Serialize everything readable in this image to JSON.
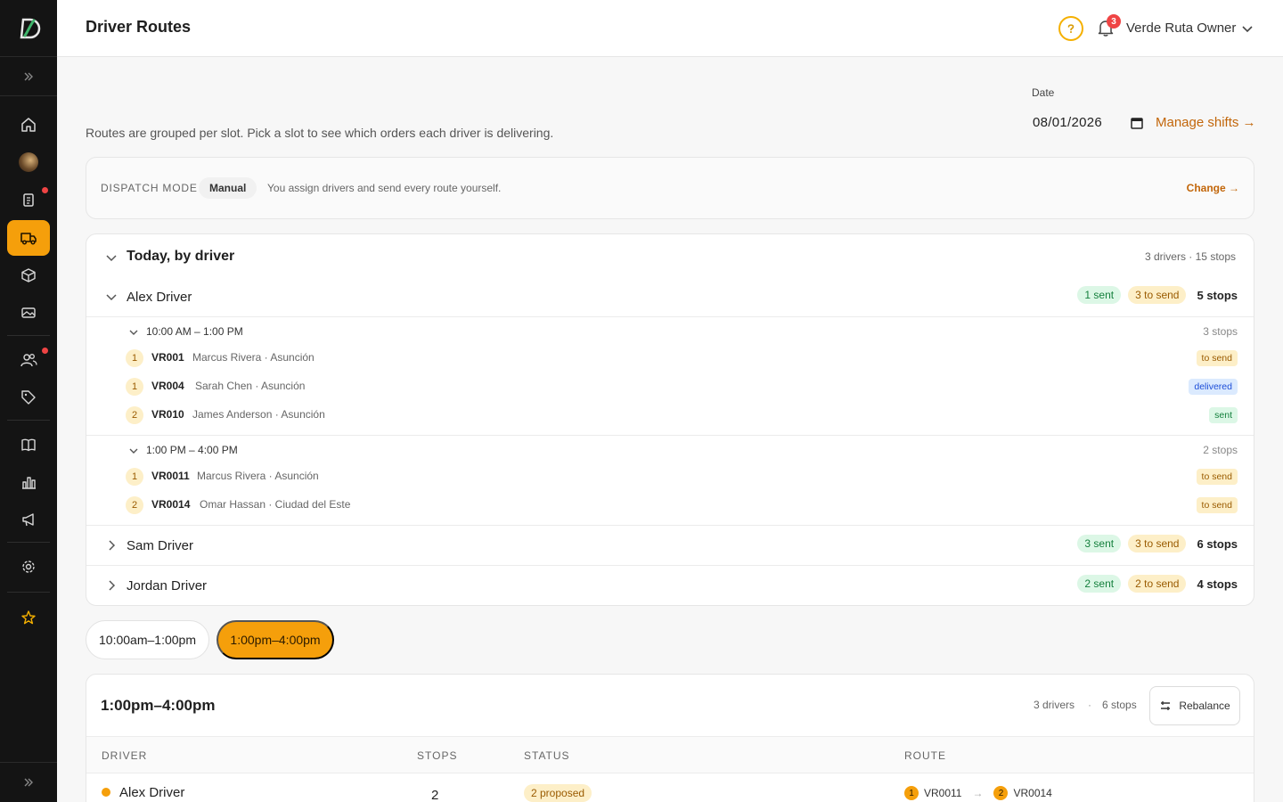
{
  "header": {
    "title": "Driver Routes",
    "notifications_count": "3",
    "user_name": "Verde Ruta Owner"
  },
  "intro": "Routes are grouped per slot. Pick a slot to see which orders each driver is delivering.",
  "date": {
    "label": "Date",
    "value": "08/01/2026",
    "manage_link": "Manage shifts →"
  },
  "dispatch": {
    "label": "DISPATCH MODE",
    "mode": "Manual",
    "description": "You assign drivers and send every route yourself.",
    "change": "Change →"
  },
  "today": {
    "title": "Today, by driver",
    "meta": "3 drivers · 15 stops",
    "drivers": [
      {
        "name": "Alex Driver",
        "sent": "1 sent",
        "to_send": "3 to send",
        "stops": "5 stops",
        "slots": [
          {
            "label": "10:00 AM – 1:00 PM",
            "stops": "3 stops",
            "orders": [
              {
                "seq": "1",
                "code": "VR001",
                "customer": "Marcus Rivera · Asunción",
                "status": "to send"
              },
              {
                "seq": "1",
                "code": "VR004",
                "customer": "Sarah Chen · Asunción",
                "status": "delivered"
              },
              {
                "seq": "2",
                "code": "VR010",
                "customer": "James Anderson · Asunción",
                "status": "sent"
              }
            ]
          },
          {
            "label": "1:00 PM – 4:00 PM",
            "stops": "2 stops",
            "orders": [
              {
                "seq": "1",
                "code": "VR0011",
                "customer": "Marcus Rivera · Asunción",
                "status": "to send"
              },
              {
                "seq": "2",
                "code": "VR0014",
                "customer": "Omar Hassan · Ciudad del Este",
                "status": "to send"
              }
            ]
          }
        ]
      },
      {
        "name": "Sam Driver",
        "sent": "3 sent",
        "to_send": "3 to send",
        "stops": "6 stops"
      },
      {
        "name": "Jordan Driver",
        "sent": "2 sent",
        "to_send": "2 to send",
        "stops": "4 stops"
      }
    ]
  },
  "slot_tabs": [
    "10:00am–1:00pm",
    "1:00pm–4:00pm"
  ],
  "slot_card": {
    "title": "1:00pm–4:00pm",
    "drivers_meta": "3 drivers",
    "separator": "·",
    "stops_meta": "6 stops",
    "rebalance": "Rebalance",
    "columns": [
      "DRIVER",
      "STOPS",
      "STATUS",
      "ROUTE"
    ],
    "rows": [
      {
        "driver": "Alex Driver",
        "stops": "2",
        "status": "2 proposed",
        "route": [
          {
            "seq": "1",
            "code": "VR0011"
          },
          {
            "seq": "2",
            "code": "VR0014"
          }
        ],
        "route_arrow": "→"
      }
    ]
  },
  "colors": {
    "accent": "#f59f0b",
    "link": "#c2660a",
    "sidebar": "#141414"
  }
}
